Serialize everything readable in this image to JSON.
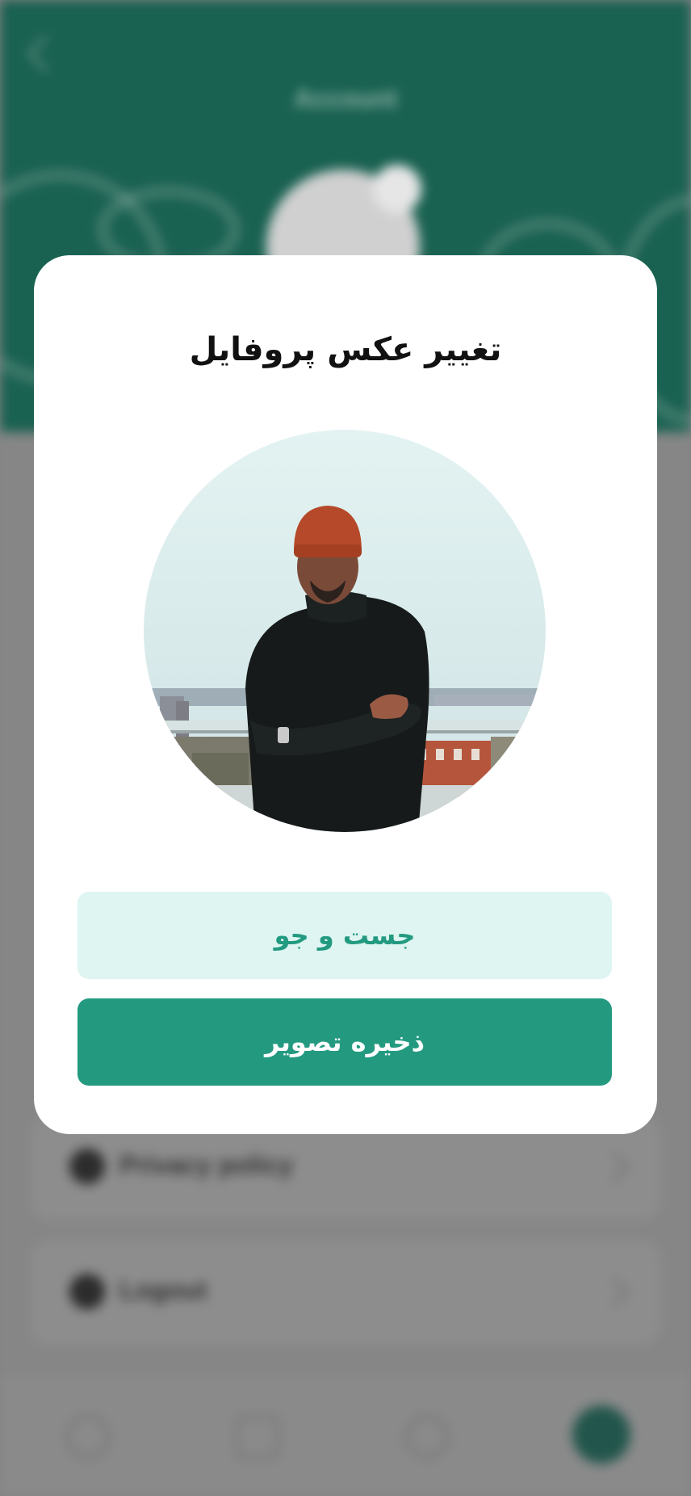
{
  "background": {
    "header_title": "Account",
    "rows": [
      {
        "label": "Privacy policy"
      },
      {
        "label": "Logout"
      }
    ]
  },
  "modal": {
    "title": "تغییر عکس پروفایل",
    "photo_alt": "profile photo",
    "search_button": "جست و جو",
    "save_button": "ذخیره تصویر"
  },
  "colors": {
    "primary": "#239a80",
    "primary_light": "#def5f1",
    "header_green": "#1b6655"
  }
}
